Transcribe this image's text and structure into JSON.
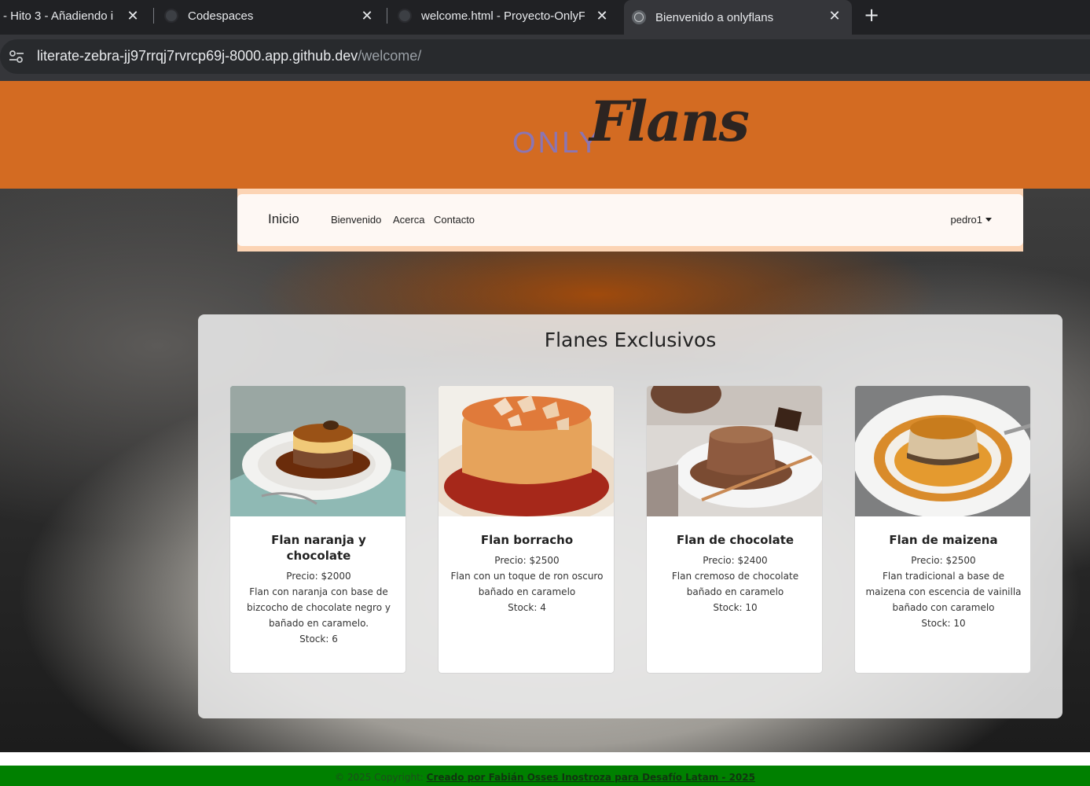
{
  "browser": {
    "tabs": [
      {
        "title": "- Hito 3 - Añadiendo i",
        "active": false
      },
      {
        "title": "Codespaces",
        "active": false
      },
      {
        "title": "welcome.html - Proyecto-OnlyF",
        "active": false
      },
      {
        "title": "Bienvenido a onlyflans",
        "active": true
      }
    ],
    "url_host": "literate-zebra-jj97rrqj7rvrcp69j-8000.app.github.dev",
    "url_path": "/welcome/"
  },
  "header": {
    "logo_only": "ONLY",
    "logo_flans": "Flans"
  },
  "nav": {
    "brand": "Inicio",
    "links": [
      "Bienvenido",
      "Acerca",
      "Contacto"
    ],
    "user": "pedro1"
  },
  "main": {
    "title": "Flanes Exclusivos",
    "products": [
      {
        "name": "Flan naranja y chocolate",
        "price": "Precio: $2000",
        "description": "Flan con naranja con base de bizcocho de chocolate negro y bañado en caramelo.",
        "stock": "Stock: 6"
      },
      {
        "name": "Flan borracho",
        "price": "Precio: $2500",
        "description": "Flan con un toque de ron oscuro bañado en caramelo",
        "stock": "Stock: 4"
      },
      {
        "name": "Flan de chocolate",
        "price": "Precio: $2400",
        "description": "Flan cremoso de chocolate bañado en caramelo",
        "stock": "Stock: 10"
      },
      {
        "name": "Flan de maizena",
        "price": "Precio: $2500",
        "description": "Flan tradicional a base de maizena con escencia de vainilla bañado con caramelo",
        "stock": "Stock: 10"
      }
    ]
  },
  "footer": {
    "prefix": "© 2025 Copyright: ",
    "link": "Creado por Fabián Osses Inostroza para Desafío Latam - 2025"
  },
  "colors": {
    "header": "#d36b22",
    "nav_band": "#fcd4b4",
    "footer": "#008000",
    "logo_only": "#8b75b3"
  }
}
